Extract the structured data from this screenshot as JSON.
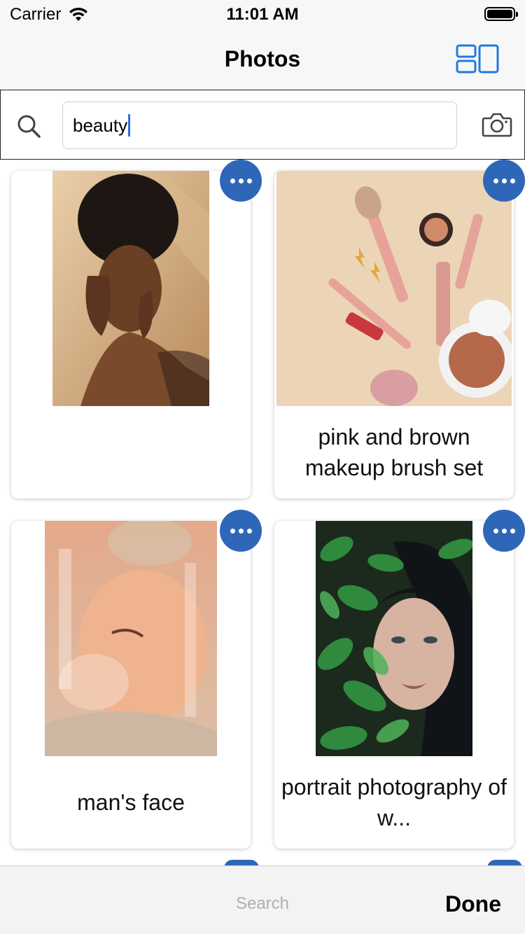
{
  "status_bar": {
    "carrier": "Carrier",
    "time": "11:01 AM"
  },
  "nav": {
    "title": "Photos",
    "layout_icon": "layout-toggle-icon",
    "accent": "#1f7ae0"
  },
  "search": {
    "value": "beauty",
    "search_icon": "search-icon",
    "camera_icon": "camera-icon"
  },
  "cards": [
    {
      "caption": "",
      "more_icon": "more-options-icon"
    },
    {
      "caption": "pink and brown makeup brush set",
      "more_icon": "more-options-icon"
    },
    {
      "caption": "man's face",
      "more_icon": "more-options-icon"
    },
    {
      "caption": "portrait photography of w...",
      "more_icon": "more-options-icon"
    }
  ],
  "bottom_bar": {
    "search_label": "Search",
    "done_label": "Done"
  },
  "colors": {
    "more_button": "#2f67b8",
    "caret": "#2f6cf0"
  }
}
